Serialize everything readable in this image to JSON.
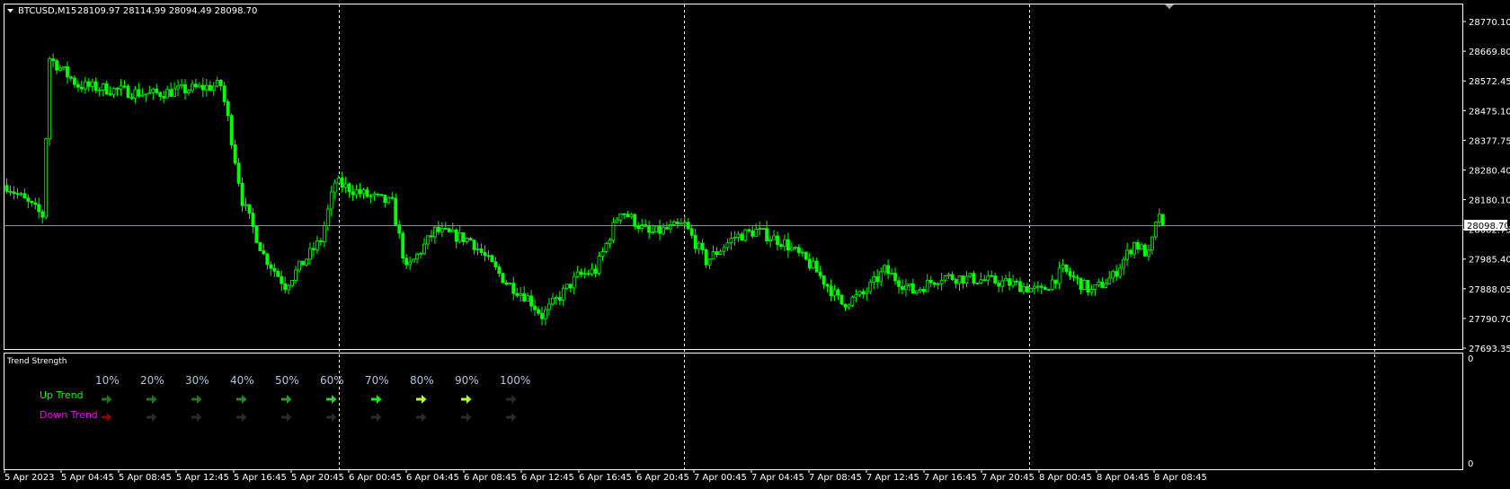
{
  "header": {
    "symbol": "BTCUSD,M15",
    "ohlc": "28109.97 28114.99 28094.49 28098.70"
  },
  "price_axis": {
    "ticks": [
      "28770.10",
      "28669.80",
      "28572.45",
      "28475.10",
      "28377.75",
      "28280.40",
      "28180.10",
      "28082.75",
      "27985.40",
      "27888.05",
      "27790.70",
      "27693.35"
    ],
    "current_price": "28098.70",
    "current_price_value": 28098.7,
    "range": [
      27693.35,
      28770.1
    ]
  },
  "time_axis": {
    "labels": [
      "5 Apr 2023",
      "5 Apr 04:45",
      "5 Apr 08:45",
      "5 Apr 12:45",
      "5 Apr 16:45",
      "5 Apr 20:45",
      "6 Apr 00:45",
      "6 Apr 04:45",
      "6 Apr 08:45",
      "6 Apr 12:45",
      "6 Apr 16:45",
      "6 Apr 20:45",
      "7 Apr 00:45",
      "7 Apr 04:45",
      "7 Apr 08:45",
      "7 Apr 12:45",
      "7 Apr 16:45",
      "7 Apr 20:45",
      "8 Apr 00:45",
      "8 Apr 04:45",
      "8 Apr 08:45"
    ]
  },
  "indicator": {
    "title": "Trend Strength",
    "axis_top": "0",
    "axis_bottom": "0",
    "levels": [
      "10%",
      "20%",
      "30%",
      "40%",
      "50%",
      "60%",
      "70%",
      "80%",
      "90%",
      "100%"
    ],
    "up_label": "Up Trend",
    "down_label": "Down Trend",
    "up_colors": [
      "#1a7a1a",
      "#1a7a1a",
      "#1a7a1a",
      "#228b22",
      "#2a9a2a",
      "#32cd32",
      "#00ff00",
      "#adff2f",
      "#adff2f",
      "#2a2a2a"
    ],
    "down_colors": [
      "#8b0000",
      "#2a2a2a",
      "#2a2a2a",
      "#2a2a2a",
      "#2a2a2a",
      "#2a2a2a",
      "#2a2a2a",
      "#2a2a2a",
      "#2a2a2a",
      "#2a2a2a"
    ],
    "up_label_color": "#00ff00",
    "down_label_color": "#ff00ff"
  },
  "chart_data": {
    "type": "candlestick",
    "timeframe": "M15",
    "bar_count": 325,
    "price_path": [
      [
        0,
        28230
      ],
      [
        10,
        28130
      ],
      [
        12,
        28650
      ],
      [
        20,
        28560
      ],
      [
        40,
        28530
      ],
      [
        60,
        28560
      ],
      [
        62,
        28450
      ],
      [
        66,
        28180
      ],
      [
        72,
        28000
      ],
      [
        78,
        27900
      ],
      [
        88,
        28050
      ],
      [
        92,
        28240
      ],
      [
        100,
        28200
      ],
      [
        108,
        28170
      ],
      [
        112,
        27950
      ],
      [
        120,
        28080
      ],
      [
        130,
        28050
      ],
      [
        140,
        27910
      ],
      [
        146,
        27860
      ],
      [
        150,
        27800
      ],
      [
        160,
        27930
      ],
      [
        165,
        27950
      ],
      [
        172,
        28150
      ],
      [
        180,
        28070
      ],
      [
        190,
        28100
      ],
      [
        196,
        27980
      ],
      [
        204,
        28060
      ],
      [
        210,
        28080
      ],
      [
        218,
        28040
      ],
      [
        226,
        27960
      ],
      [
        234,
        27840
      ],
      [
        240,
        27870
      ],
      [
        246,
        27950
      ],
      [
        254,
        27880
      ],
      [
        262,
        27930
      ],
      [
        272,
        27920
      ],
      [
        282,
        27905
      ],
      [
        290,
        27880
      ],
      [
        296,
        27950
      ],
      [
        304,
        27880
      ],
      [
        310,
        27930
      ],
      [
        316,
        28040
      ],
      [
        320,
        28000
      ],
      [
        323,
        28140
      ],
      [
        324,
        28098.7
      ]
    ],
    "candle_color": "#00ff00"
  }
}
